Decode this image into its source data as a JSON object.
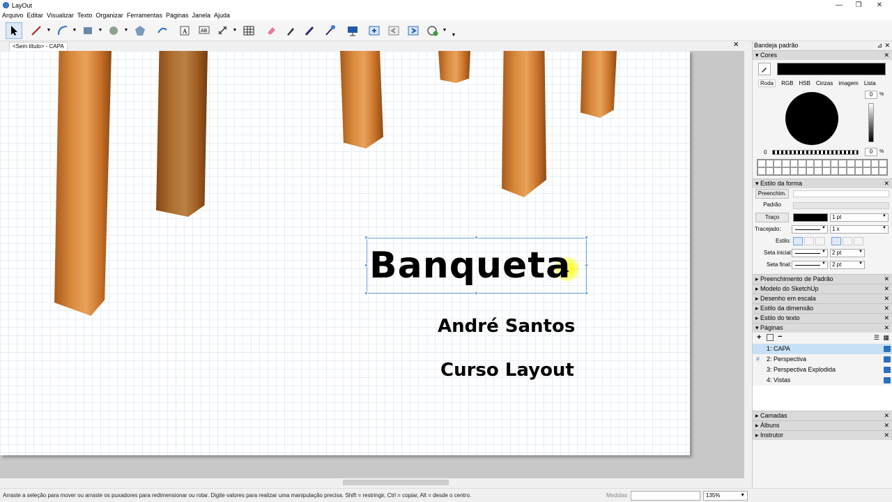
{
  "window": {
    "title": "LayOut"
  },
  "menu": [
    "Arquivo",
    "Editar",
    "Visualizar",
    "Texto",
    "Organizar",
    "Ferramentas",
    "Páginas",
    "Janela",
    "Ajuda"
  ],
  "tab": {
    "label": "<Sem título> - CAPA"
  },
  "document": {
    "title": "Banqueta",
    "author": "André Santos",
    "course": "Curso Layout"
  },
  "status": {
    "hint": "Arraste a seleção para mover ou arraste os puxadores para redimensionar ou rotar. Digite valores para realizar uma manipulação precisa. Shift = restringir, Ctrl = copiar, Alt = desde o centro.",
    "medidas_label": "Medidas",
    "zoom": "135%"
  },
  "tray": {
    "title": "Bandeja padrão",
    "cores": {
      "header": "Cores",
      "tabs": [
        "Roda",
        "RGB",
        "HSB",
        "Cinzas",
        "imagem",
        "Lista"
      ],
      "value_top": "0",
      "value_bottom": "0",
      "percent": "%",
      "zero_label": "0",
      "current_color": "#000000"
    },
    "estilo_forma": {
      "header": "Estilo da forma",
      "preenchim": "Preenchim.",
      "padrao": "Padrão",
      "traco": "Traço",
      "traco_width": "1 pt",
      "tracejado": "Tracejado:",
      "tracejado_scale": "1 x",
      "estilo": "Estilo:",
      "seta_inicial": "Seta inicial:",
      "seta_inicial_size": "2 pt",
      "seta_final": "Seta final:",
      "seta_final_size": "2 pt"
    },
    "collapsed_panels": [
      "Preenchimento de Padrão",
      "Modelo do SketchUp",
      "Desenho em escala",
      "Estilo da dimensão",
      "Estilo do texto"
    ],
    "paginas": {
      "header": "Páginas",
      "items": [
        "1: CAPA",
        "2: Perspectiva",
        "3: Perspectiva Explodida",
        "4: Vistas"
      ]
    },
    "bottom_panels": [
      "Camadas",
      "Álbuns",
      "Instrutor"
    ]
  }
}
